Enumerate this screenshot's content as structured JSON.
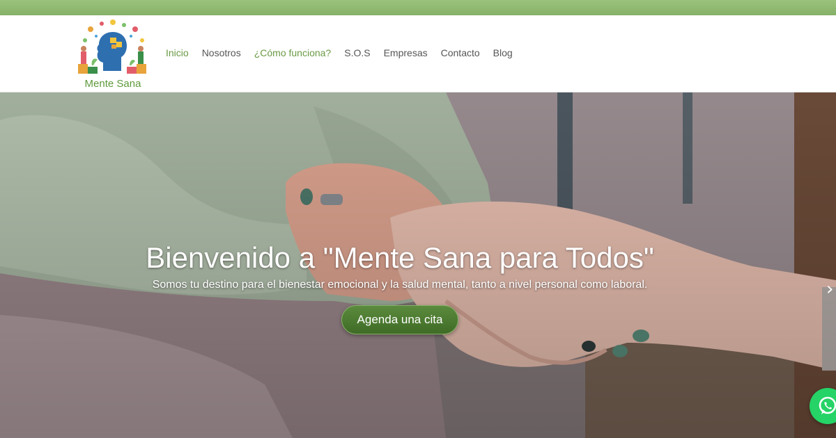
{
  "brand": {
    "name": "Mente Sana",
    "accent_color": "#6a9a45",
    "strip_color": "#8fb873"
  },
  "nav": {
    "items": [
      {
        "label": "Inicio",
        "state": "active"
      },
      {
        "label": "Nosotros",
        "state": "normal"
      },
      {
        "label": "¿Cómo funciona?",
        "state": "highlight"
      },
      {
        "label": "S.O.S",
        "state": "normal"
      },
      {
        "label": "Empresas",
        "state": "normal"
      },
      {
        "label": "Contacto",
        "state": "normal"
      },
      {
        "label": "Blog",
        "state": "normal"
      }
    ]
  },
  "hero": {
    "title": "Bienvenido a \"Mente Sana para Todos\"",
    "subtitle": "Somos tu destino para el bienestar emocional y la salud mental, tanto a nivel personal como laboral.",
    "cta_label": "Agenda una cita",
    "next_arrow": "›",
    "background_icon": "holding-hands-photo"
  },
  "floating": {
    "whatsapp_icon": "whatsapp-icon",
    "whatsapp_color": "#25d366"
  }
}
